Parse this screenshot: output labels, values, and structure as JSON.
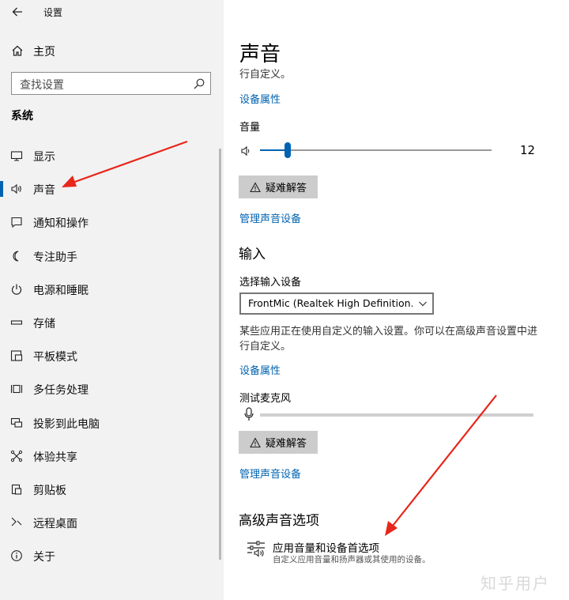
{
  "window": {
    "title": "设置"
  },
  "sidebar": {
    "home_label": "主页",
    "search_placeholder": "查找设置",
    "section_title": "系统",
    "items": [
      {
        "label": "显示",
        "icon": "display-icon"
      },
      {
        "label": "声音",
        "icon": "speaker-icon",
        "active": true
      },
      {
        "label": "通知和操作",
        "icon": "notification-icon"
      },
      {
        "label": "专注助手",
        "icon": "moon-icon"
      },
      {
        "label": "电源和睡眠",
        "icon": "power-icon"
      },
      {
        "label": "存储",
        "icon": "storage-icon"
      },
      {
        "label": "平板模式",
        "icon": "tablet-icon"
      },
      {
        "label": "多任务处理",
        "icon": "multitask-icon"
      },
      {
        "label": "投影到此电脑",
        "icon": "project-icon"
      },
      {
        "label": "体验共享",
        "icon": "share-icon"
      },
      {
        "label": "剪贴板",
        "icon": "clipboard-icon"
      },
      {
        "label": "远程桌面",
        "icon": "remote-icon"
      },
      {
        "label": "关于",
        "icon": "info-icon"
      }
    ]
  },
  "main": {
    "title": "声音",
    "output_desc_tail": "行自定义。",
    "output_device_props": "设备属性",
    "volume_label": "音量",
    "volume_value": "12",
    "volume_level": 12,
    "troubleshoot_label": "疑难解答",
    "manage_devices": "管理声音设备",
    "input_heading": "输入",
    "input_select_label": "选择输入设备",
    "input_selected": "FrontMic (Realtek High Definition...",
    "input_desc_line1": "某些应用正在使用自定义的输入设置。你可以在高级声音设置中进",
    "input_desc_line2": "行自定义。",
    "input_device_props": "设备属性",
    "test_mic_label": "测试麦克风",
    "troubleshoot_label_2": "疑难解答",
    "manage_devices_2": "管理声音设备",
    "advanced_heading": "高级声音选项",
    "advanced_item_title": "应用音量和设备首选项",
    "advanced_item_subtitle": "自定义应用音量和扬声器或其使用的设备。"
  },
  "watermark": "知乎用户",
  "colors": {
    "accent": "#0063b1",
    "sidebar_bg": "#f2f2f2",
    "arrow": "#e8261b"
  }
}
